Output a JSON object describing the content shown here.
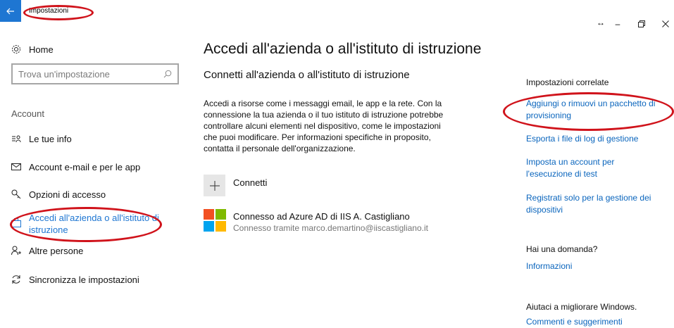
{
  "window": {
    "title": "Impostazioni",
    "controls": [
      "↔",
      "–",
      "▢",
      "×"
    ]
  },
  "sidebar": {
    "home": "Home",
    "search_placeholder": "Trova un'impostazione",
    "section": "Account",
    "items": [
      {
        "label": "Le tue info",
        "icon": "user-info-icon"
      },
      {
        "label": "Account e-mail e per le app",
        "icon": "mail-icon"
      },
      {
        "label": "Opzioni di accesso",
        "icon": "key-icon"
      },
      {
        "label_line1": "Accedi all'azienda o all'istituto di",
        "label_line2": "istruzione",
        "icon": "briefcase-icon",
        "selected": true
      },
      {
        "label": "Altre persone",
        "icon": "person-add-icon"
      },
      {
        "label": "Sincronizza le impostazioni",
        "icon": "sync-icon"
      }
    ]
  },
  "main": {
    "title": "Accedi all'azienda o all'istituto di istruzione",
    "subtitle": "Connetti all'azienda o all'istituto di istruzione",
    "description_lines": [
      "Accedi a risorse come i messaggi email, le app e la rete. Con la",
      "connessione la tua azienda o il tuo istituto di istruzione potrebbe",
      "controllare alcuni elementi nel dispositivo, come le impostazioni",
      "che puoi modificare. Per informazioni specifiche in proposito,",
      "contatta il personale dell'organizzazione."
    ],
    "connect_label": "Connetti",
    "account_title": "Connesso ad Azure AD di IIS A. Castigliano",
    "account_sub": "Connesso tramite marco.demartino@iiscastigliano.it"
  },
  "related": {
    "heading": "Impostazioni correlate",
    "links": [
      {
        "line1": "Aggiungi o rimuovi un pacchetto di",
        "line2": "provisioning"
      },
      {
        "line1": "Esporta i file di log di gestione",
        "line2": ""
      },
      {
        "line1": "Imposta un account per",
        "line2": "l'esecuzione di test"
      },
      {
        "line1": "Registrati solo per la gestione dei",
        "line2": "dispositivi"
      }
    ],
    "question_heading": "Hai una domanda?",
    "question_link": "Informazioni",
    "improve_heading": "Aiutaci a migliorare Windows.",
    "improve_link": "Commenti e suggerimenti"
  },
  "colors": {
    "accent": "#1e76d2",
    "link": "#0a65bd",
    "annotation": "#d0131b"
  }
}
